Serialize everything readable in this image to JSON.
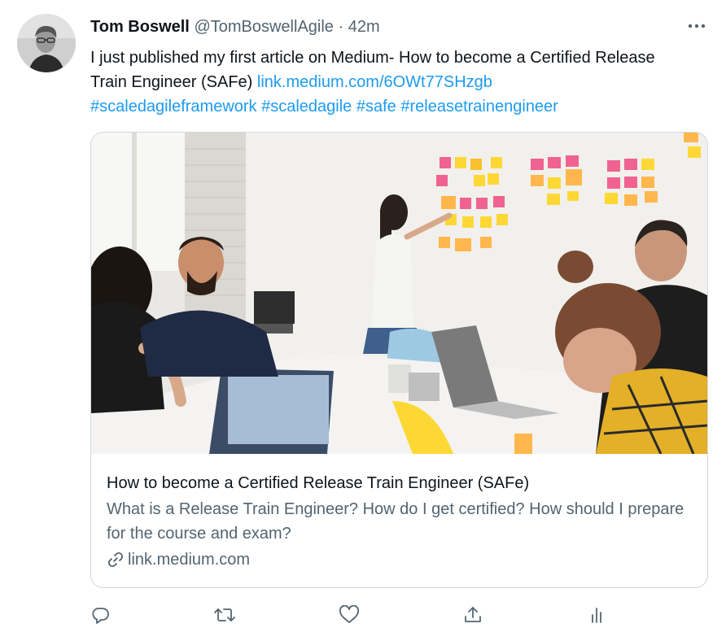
{
  "tweet": {
    "author_name": "Tom Boswell",
    "author_handle": "@TomBoswellAgile",
    "separator": "·",
    "time": "42m",
    "text_plain": "I just published my first article on Medium- How to become a Certified Release Train Engineer (SAFe) ",
    "link_text": "link.medium.com/6OWt77SHzgb",
    "hashtags": [
      "#scaledagileframework",
      "#scaledagile",
      "#safe",
      "#releasetrainengineer"
    ]
  },
  "card": {
    "title": "How to become a Certified Release Train Engineer (SAFe)",
    "description": "What is a Release Train Engineer? How do I get certified? How should I prepare for the course and exam?",
    "domain": "link.medium.com"
  },
  "icons": {
    "more": "more-horizontal-icon",
    "reply": "reply-icon",
    "retweet": "retweet-icon",
    "like": "heart-icon",
    "share": "share-icon",
    "analytics": "analytics-icon",
    "link": "link-icon"
  },
  "colors": {
    "link": "#1d9bf0",
    "secondary": "#536471",
    "border": "#cfd9de",
    "text": "#0f1419"
  }
}
